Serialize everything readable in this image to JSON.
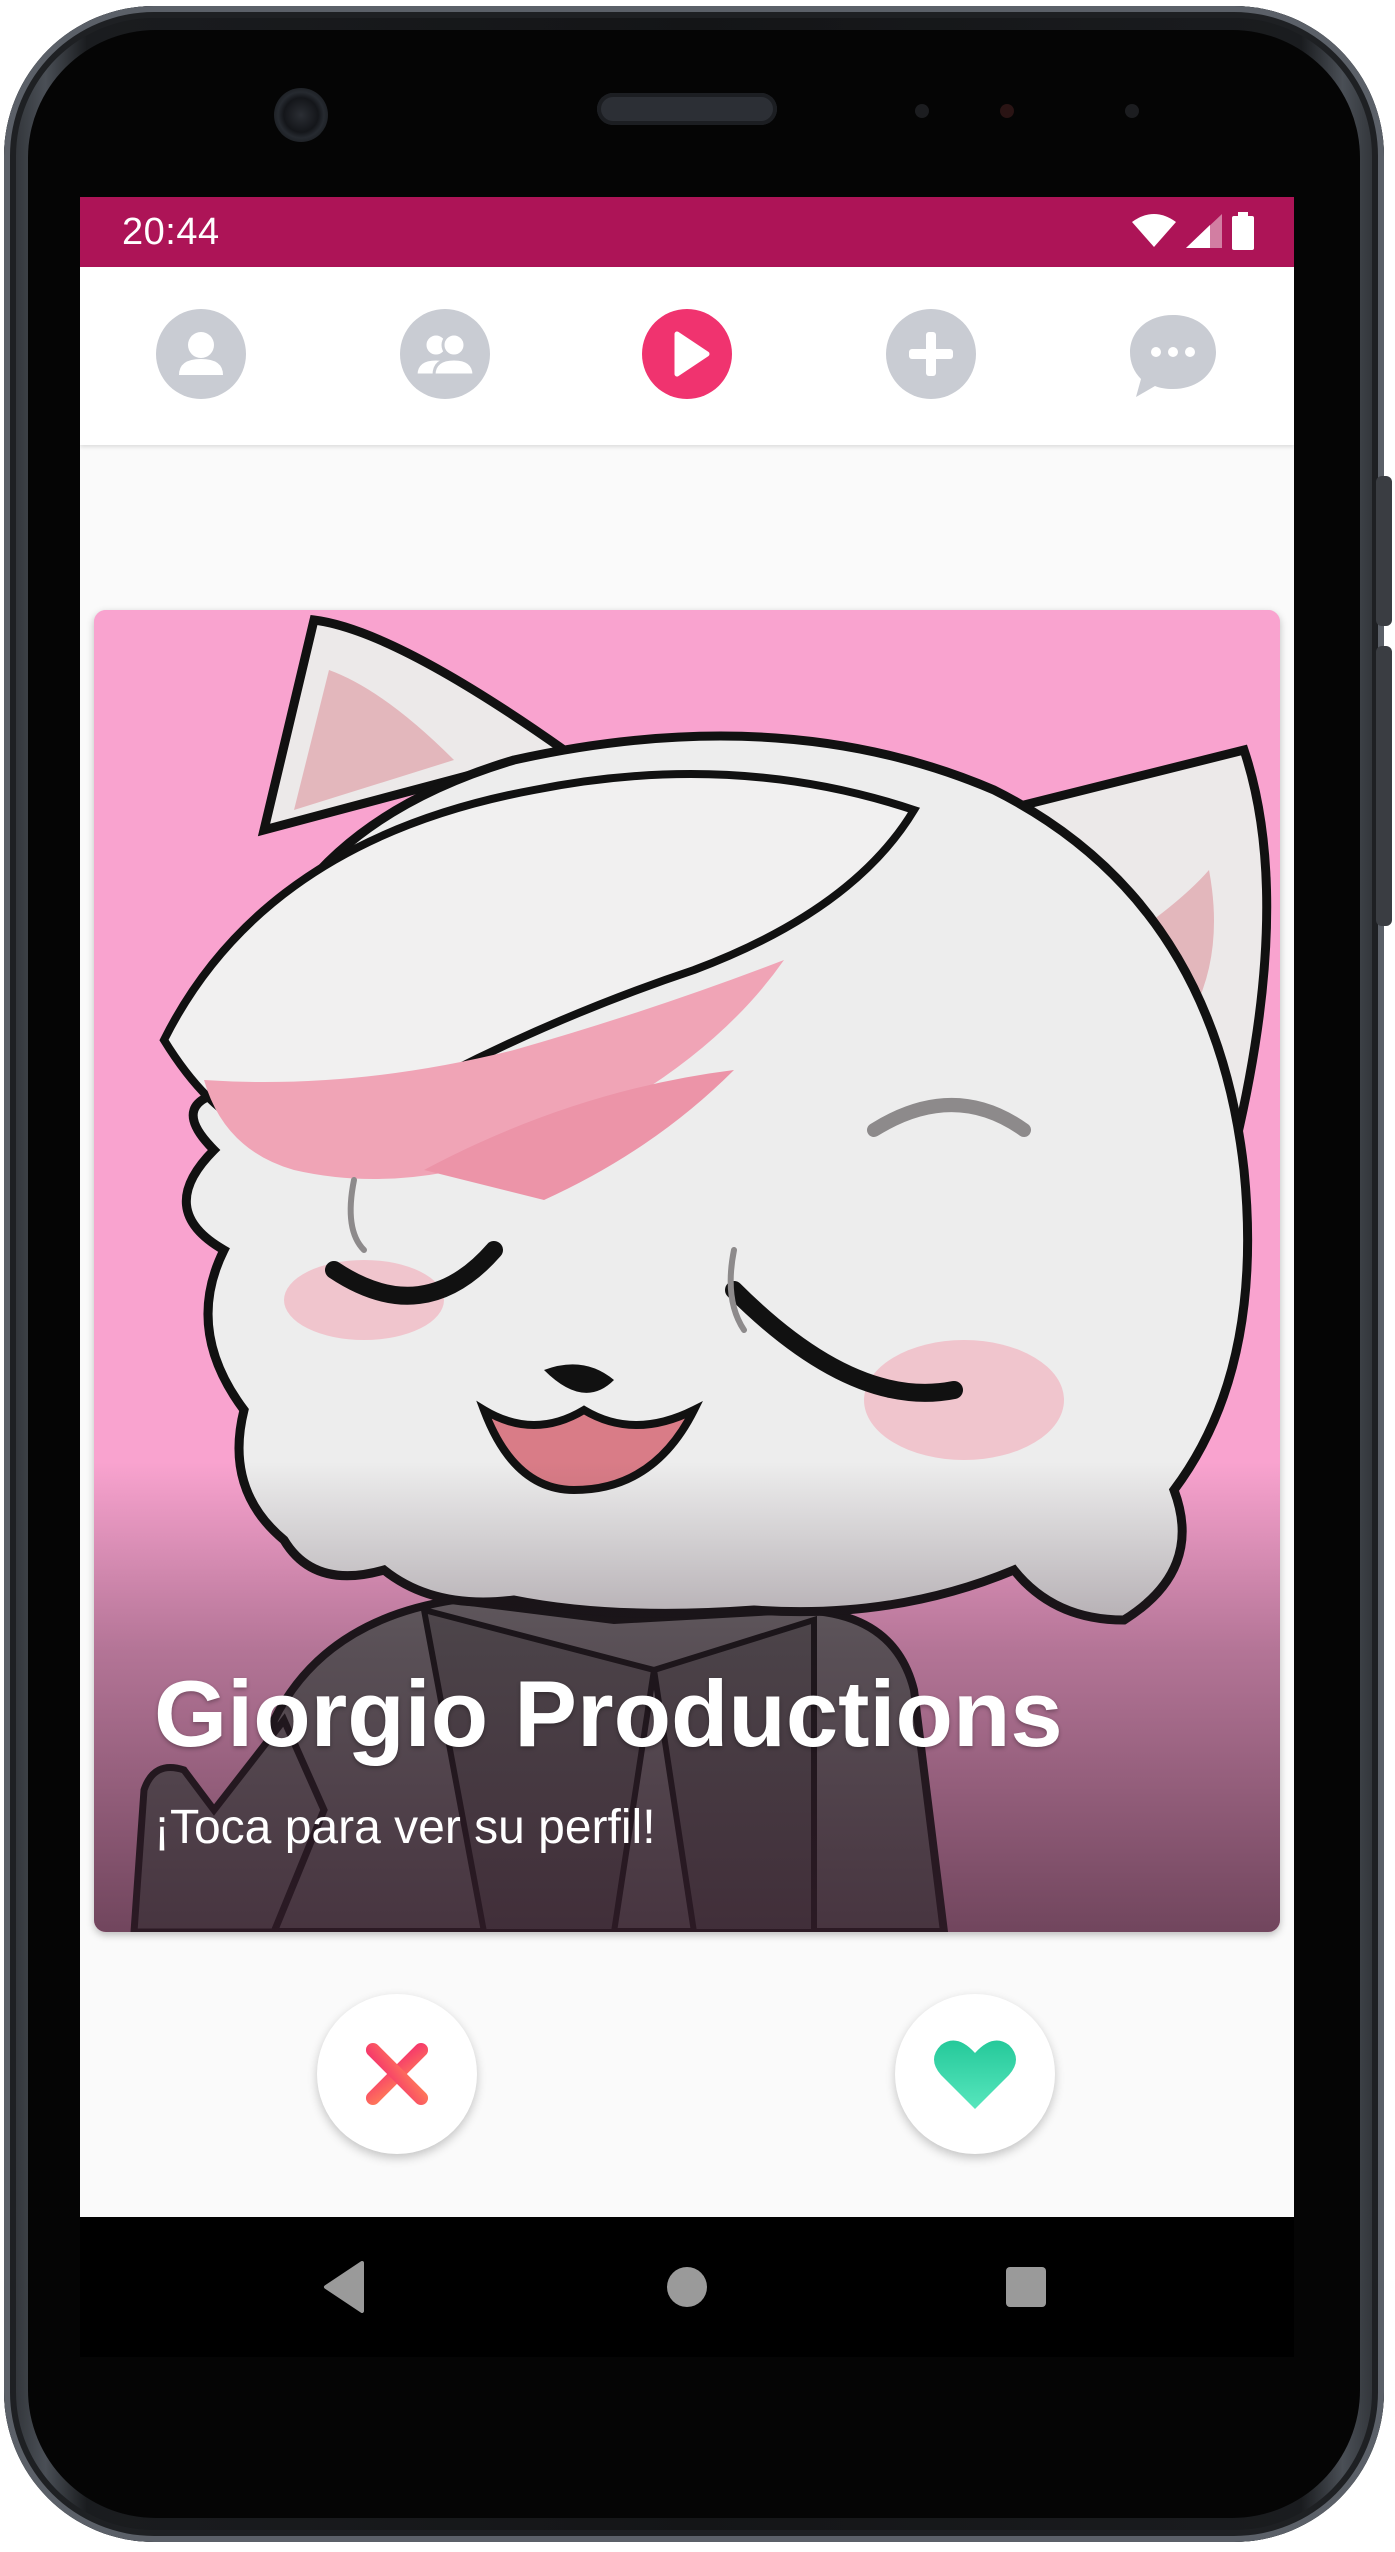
{
  "status_bar": {
    "time": "20:44",
    "background_color": "#ad1457",
    "icons": [
      "wifi-icon",
      "cell-signal-icon",
      "battery-icon"
    ]
  },
  "top_nav": {
    "items": [
      {
        "name": "profile",
        "icon": "person-icon",
        "active": false
      },
      {
        "name": "matches",
        "icon": "people-icon",
        "active": false
      },
      {
        "name": "discover",
        "icon": "play-icon",
        "active": true
      },
      {
        "name": "add",
        "icon": "plus-icon",
        "active": false
      },
      {
        "name": "chats",
        "icon": "chat-bubble-icon",
        "active": false
      }
    ],
    "active_color": "#f0336f",
    "inactive_color": "#c9ccd3"
  },
  "card": {
    "title": "Giorgio Productions",
    "subtitle": "¡Toca para ver su perfil!",
    "background_color": "#f9a3cf",
    "image": "cartoon-cat-avatar"
  },
  "actions": {
    "dislike": {
      "icon": "close-x-icon",
      "color": "#f0336f"
    },
    "like": {
      "icon": "heart-icon",
      "color": "#2fd8a7"
    }
  },
  "system_nav": {
    "buttons": [
      "back-icon",
      "home-icon",
      "recents-icon"
    ]
  }
}
